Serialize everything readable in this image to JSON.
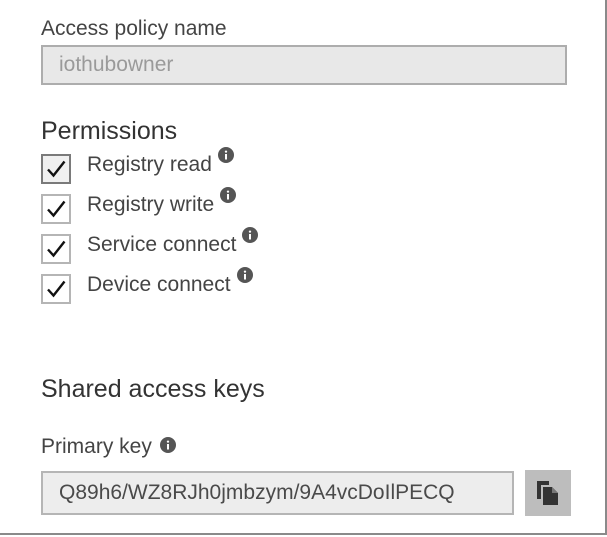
{
  "policy": {
    "label": "Access policy name",
    "value": "iothubowner"
  },
  "permissions": {
    "title": "Permissions",
    "items": [
      {
        "label": "Registry read",
        "checked": true,
        "icon": "info-icon"
      },
      {
        "label": "Registry write",
        "checked": true,
        "icon": "info-icon"
      },
      {
        "label": "Service connect",
        "checked": true,
        "icon": "info-icon"
      },
      {
        "label": "Device connect",
        "checked": true,
        "icon": "info-icon"
      }
    ]
  },
  "shared_keys": {
    "title": "Shared access keys",
    "primary_key_label": "Primary key",
    "primary_key_value": "Q89h6/WZ8RJh0jmbzym/9A4vcDoIlPECQ",
    "copy_icon": "copy-icon"
  }
}
